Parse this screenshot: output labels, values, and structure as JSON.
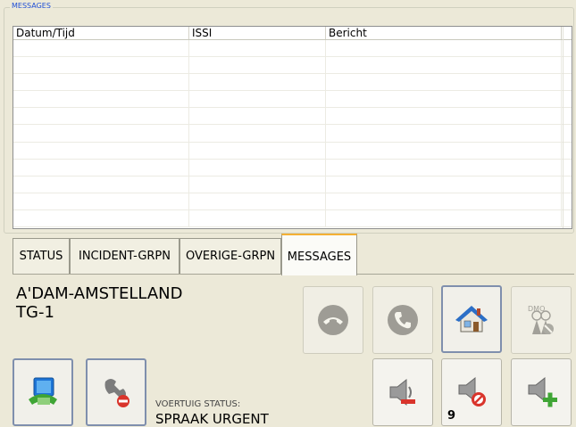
{
  "messages": {
    "group_title": "MESSAGES",
    "columns": [
      "Datum/Tijd",
      "ISSI",
      "Bericht"
    ],
    "rows": [
      [],
      [],
      [],
      [],
      [],
      [],
      [],
      [],
      [],
      [],
      []
    ]
  },
  "tabs": [
    {
      "label": "STATUS",
      "active": false
    },
    {
      "label": "INCIDENT-GRPN",
      "active": false
    },
    {
      "label": "OVERIGE-GRPN",
      "active": false
    },
    {
      "label": "MESSAGES",
      "active": true
    }
  ],
  "talkgroup": {
    "line1": "A'DAM-AMSTELLAND",
    "line2": "TG-1"
  },
  "vehicle_status": {
    "label": "VOERTUIG STATUS:",
    "value": "SPRAAK URGENT"
  },
  "controls": {
    "hangup": {
      "icon": "phone-hangup-icon",
      "enabled": false
    },
    "call": {
      "icon": "phone-call-icon",
      "enabled": false
    },
    "home": {
      "icon": "home-icon",
      "enabled": true
    },
    "dmo": {
      "icon": "dmo-icon",
      "enabled": false,
      "label": "DMO"
    },
    "volume_down": {
      "icon": "speaker-minus-icon",
      "enabled": true
    },
    "mute": {
      "icon": "speaker-mute-icon",
      "enabled": true,
      "count": "9"
    },
    "volume_up": {
      "icon": "speaker-plus-icon",
      "enabled": true
    },
    "network": {
      "icon": "network-computer-icon",
      "enabled": true
    },
    "settings": {
      "icon": "wrench-icon",
      "enabled": true
    }
  },
  "colors": {
    "background": "#ece9d8",
    "active_tab_accent": "#f4b033",
    "legend_text": "#1f4fd6",
    "mute_red": "#d9342b",
    "plus_green": "#3fa535"
  }
}
